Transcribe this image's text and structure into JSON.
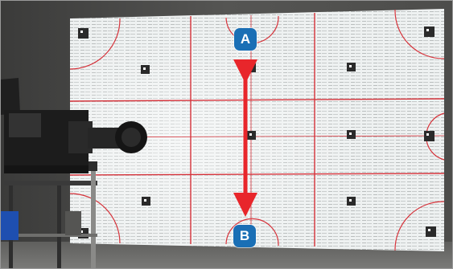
{
  "markers": {
    "top_label": "A",
    "bottom_label": "B"
  },
  "colors": {
    "marker_fill": "#1a6fb5",
    "arrow": "#e8262b",
    "screen": "#eef1f1",
    "grid_line": "#d6323a",
    "wall": "#4a4a48"
  }
}
